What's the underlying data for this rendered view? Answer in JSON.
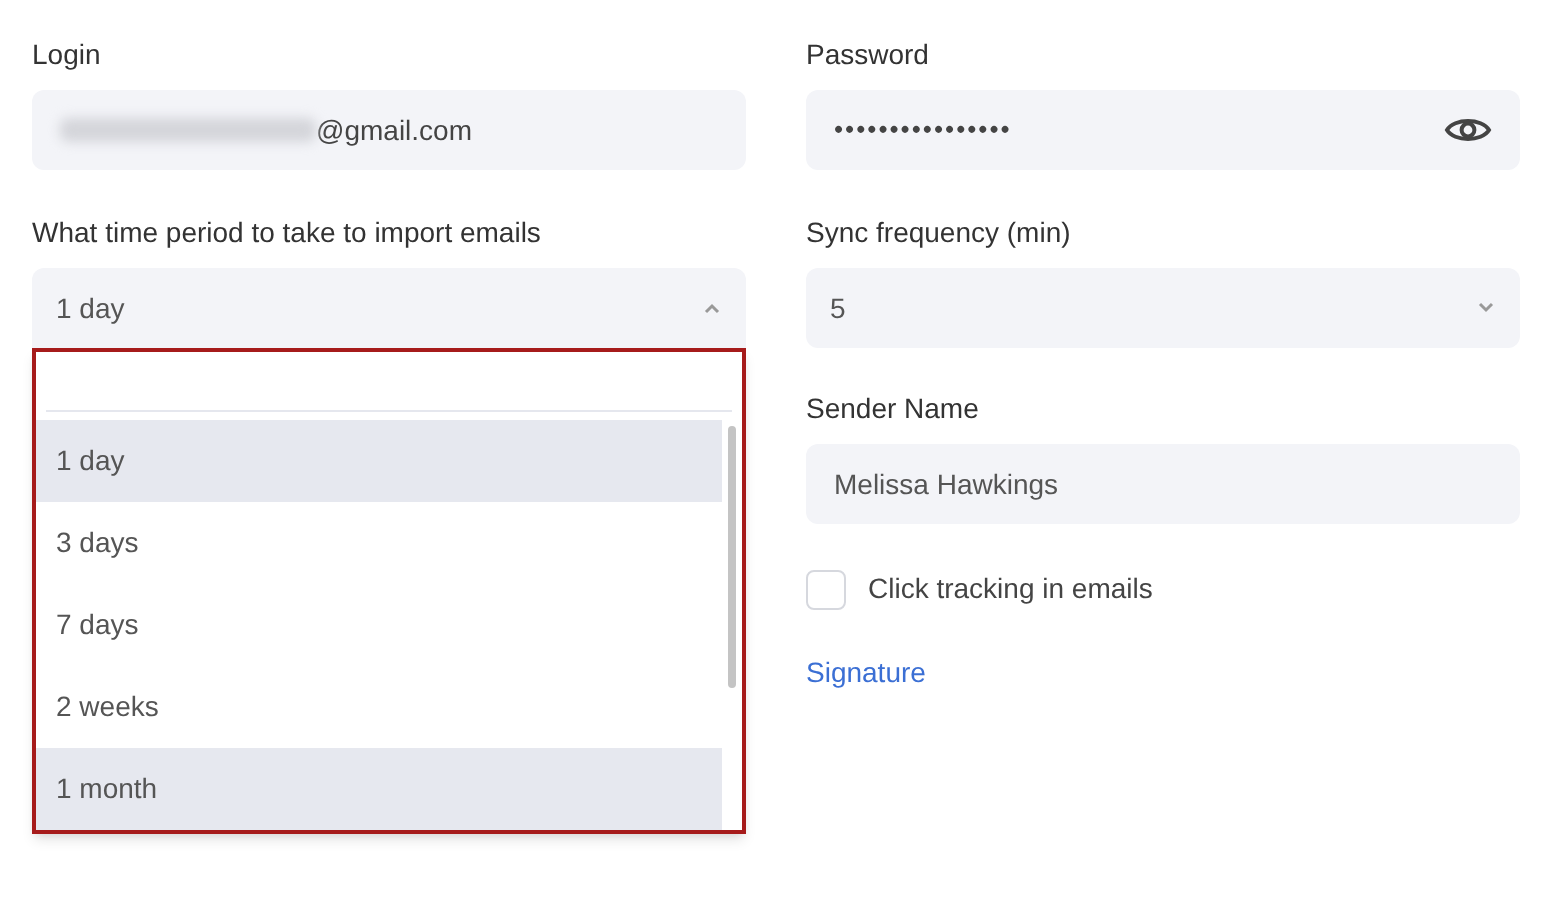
{
  "login": {
    "label": "Login",
    "value": "@gmail.com"
  },
  "password": {
    "label": "Password",
    "value": "••••••••••••••••"
  },
  "time_period": {
    "label": "What time period to take to import emails",
    "value": "1 day",
    "expanded": true,
    "options": [
      {
        "label": "1 day",
        "highlighted": true
      },
      {
        "label": "3 days",
        "highlighted": false
      },
      {
        "label": "7 days",
        "highlighted": false
      },
      {
        "label": "2 weeks",
        "highlighted": false
      },
      {
        "label": "1 month",
        "highlighted": true
      }
    ]
  },
  "sync_frequency": {
    "label": "Sync frequency (min)",
    "value": "5",
    "expanded": false
  },
  "sender_name": {
    "label": "Sender Name",
    "value": "Melissa Hawkings"
  },
  "click_tracking": {
    "label": "Click tracking in emails",
    "checked": false
  },
  "signature_link": "Signature"
}
